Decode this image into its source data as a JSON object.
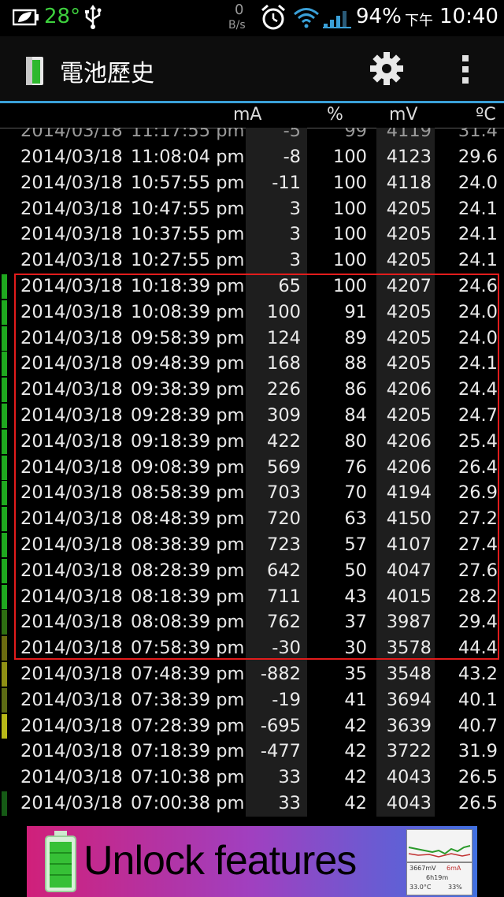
{
  "status_bar": {
    "temperature": "28°",
    "net_speed_value": "0",
    "net_speed_unit": "B/s",
    "battery_percent": "94%",
    "am_pm": "下午",
    "time": "10:40"
  },
  "app": {
    "title": "電池歷史"
  },
  "columns": {
    "ma": "mA",
    "pct": "%",
    "mv": "mV",
    "temp": "ºC"
  },
  "partial_row": {
    "date": "2014/03/18",
    "time": "11:17:55 pm",
    "ma": "-5",
    "pct": "99",
    "mv": "4119",
    "temp": "31.4"
  },
  "rows": [
    {
      "date": "2014/03/18",
      "time": "11:08:04 pm",
      "ma": "-8",
      "pct": "100",
      "mv": "4123",
      "temp": "29.6",
      "bar": ""
    },
    {
      "date": "2014/03/18",
      "time": "10:57:55 pm",
      "ma": "-11",
      "pct": "100",
      "mv": "4118",
      "temp": "24.0",
      "bar": ""
    },
    {
      "date": "2014/03/18",
      "time": "10:47:55 pm",
      "ma": "3",
      "pct": "100",
      "mv": "4205",
      "temp": "24.1",
      "bar": ""
    },
    {
      "date": "2014/03/18",
      "time": "10:37:55 pm",
      "ma": "3",
      "pct": "100",
      "mv": "4205",
      "temp": "24.1",
      "bar": ""
    },
    {
      "date": "2014/03/18",
      "time": "10:27:55 pm",
      "ma": "3",
      "pct": "100",
      "mv": "4205",
      "temp": "24.1",
      "bar": ""
    },
    {
      "date": "2014/03/18",
      "time": "10:18:39 pm",
      "ma": "65",
      "pct": "100",
      "mv": "4207",
      "temp": "24.6",
      "bar": "#1fa81f"
    },
    {
      "date": "2014/03/18",
      "time": "10:08:39 pm",
      "ma": "100",
      "pct": "91",
      "mv": "4205",
      "temp": "24.0",
      "bar": "#1fa81f"
    },
    {
      "date": "2014/03/18",
      "time": "09:58:39 pm",
      "ma": "124",
      "pct": "89",
      "mv": "4205",
      "temp": "24.0",
      "bar": "#1fa81f"
    },
    {
      "date": "2014/03/18",
      "time": "09:48:39 pm",
      "ma": "168",
      "pct": "88",
      "mv": "4205",
      "temp": "24.1",
      "bar": "#1fa81f"
    },
    {
      "date": "2014/03/18",
      "time": "09:38:39 pm",
      "ma": "226",
      "pct": "86",
      "mv": "4206",
      "temp": "24.4",
      "bar": "#1fa81f"
    },
    {
      "date": "2014/03/18",
      "time": "09:28:39 pm",
      "ma": "309",
      "pct": "84",
      "mv": "4205",
      "temp": "24.7",
      "bar": "#1fa81f"
    },
    {
      "date": "2014/03/18",
      "time": "09:18:39 pm",
      "ma": "422",
      "pct": "80",
      "mv": "4206",
      "temp": "25.4",
      "bar": "#1fa81f"
    },
    {
      "date": "2014/03/18",
      "time": "09:08:39 pm",
      "ma": "569",
      "pct": "76",
      "mv": "4206",
      "temp": "26.4",
      "bar": "#1fa81f"
    },
    {
      "date": "2014/03/18",
      "time": "08:58:39 pm",
      "ma": "703",
      "pct": "70",
      "mv": "4194",
      "temp": "26.9",
      "bar": "#1fa81f"
    },
    {
      "date": "2014/03/18",
      "time": "08:48:39 pm",
      "ma": "720",
      "pct": "63",
      "mv": "4150",
      "temp": "27.2",
      "bar": "#1fa81f"
    },
    {
      "date": "2014/03/18",
      "time": "08:38:39 pm",
      "ma": "723",
      "pct": "57",
      "mv": "4107",
      "temp": "27.4",
      "bar": "#1fa81f"
    },
    {
      "date": "2014/03/18",
      "time": "08:28:39 pm",
      "ma": "642",
      "pct": "50",
      "mv": "4047",
      "temp": "27.6",
      "bar": "#1fa81f"
    },
    {
      "date": "2014/03/18",
      "time": "08:18:39 pm",
      "ma": "711",
      "pct": "43",
      "mv": "4015",
      "temp": "28.2",
      "bar": "#1fa81f"
    },
    {
      "date": "2014/03/18",
      "time": "08:08:39 pm",
      "ma": "762",
      "pct": "37",
      "mv": "3987",
      "temp": "29.4",
      "bar": "#2e6e12"
    },
    {
      "date": "2014/03/18",
      "time": "07:58:39 pm",
      "ma": "-30",
      "pct": "30",
      "mv": "3578",
      "temp": "44.4",
      "bar": "#6b6b10"
    },
    {
      "date": "2014/03/18",
      "time": "07:48:39 pm",
      "ma": "-882",
      "pct": "35",
      "mv": "3548",
      "temp": "43.2",
      "bar": "#8f8f14"
    },
    {
      "date": "2014/03/18",
      "time": "07:38:39 pm",
      "ma": "-19",
      "pct": "41",
      "mv": "3694",
      "temp": "40.1",
      "bar": "#5d6b14"
    },
    {
      "date": "2014/03/18",
      "time": "07:28:39 pm",
      "ma": "-695",
      "pct": "42",
      "mv": "3639",
      "temp": "40.7",
      "bar": "#b8b818"
    },
    {
      "date": "2014/03/18",
      "time": "07:18:39 pm",
      "ma": "-477",
      "pct": "42",
      "mv": "3722",
      "temp": "31.9",
      "bar": ""
    },
    {
      "date": "2014/03/18",
      "time": "07:10:38 pm",
      "ma": "33",
      "pct": "42",
      "mv": "4043",
      "temp": "26.5",
      "bar": ""
    },
    {
      "date": "2014/03/18",
      "time": "07:00:38 pm",
      "ma": "33",
      "pct": "42",
      "mv": "4043",
      "temp": "26.5",
      "bar": "#155a15"
    }
  ],
  "ad": {
    "text": "Unlock features",
    "thumb_line1": "3667mV",
    "thumb_line1b": "6mA",
    "thumb_line2": "6h19m",
    "thumb_line3": "33.0°C",
    "thumb_line3b": "33%"
  },
  "colors": {
    "accent": "#3aa0d8",
    "highlight": "#e21c1c",
    "charge_bar": "#1fa81f"
  }
}
